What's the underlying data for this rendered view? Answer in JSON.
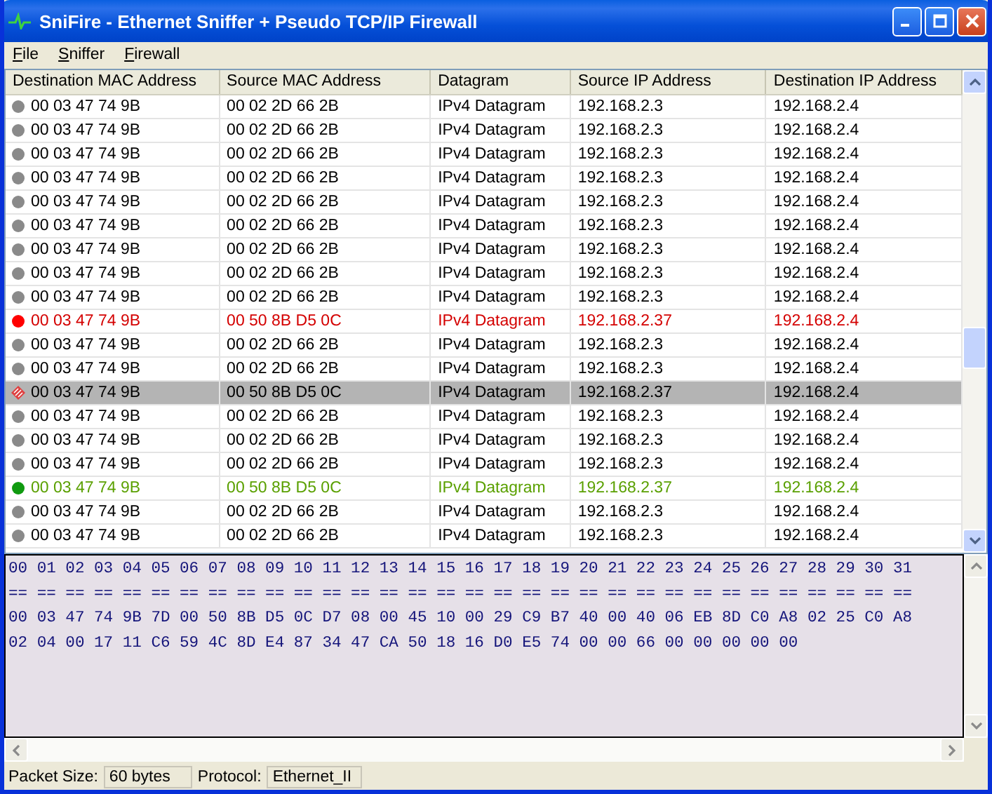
{
  "window": {
    "title": "SniFire - Ethernet Sniffer + Pseudo TCP/IP Firewall"
  },
  "menu": [
    {
      "label": "File"
    },
    {
      "label": "Sniffer"
    },
    {
      "label": "Firewall"
    }
  ],
  "columns": [
    "Destination MAC Address",
    "Source MAC Address",
    "Datagram",
    "Source IP Address",
    "Destination IP Address"
  ],
  "rows": [
    {
      "kind": "normal",
      "selected": false,
      "cells": [
        "00 03 47 74 9B",
        "00 02 2D 66 2B",
        "IPv4 Datagram",
        "192.168.2.3",
        "192.168.2.4"
      ]
    },
    {
      "kind": "normal",
      "selected": false,
      "cells": [
        "00 03 47 74 9B",
        "00 02 2D 66 2B",
        "IPv4 Datagram",
        "192.168.2.3",
        "192.168.2.4"
      ]
    },
    {
      "kind": "normal",
      "selected": false,
      "cells": [
        "00 03 47 74 9B",
        "00 02 2D 66 2B",
        "IPv4 Datagram",
        "192.168.2.3",
        "192.168.2.4"
      ]
    },
    {
      "kind": "normal",
      "selected": false,
      "cells": [
        "00 03 47 74 9B",
        "00 02 2D 66 2B",
        "IPv4 Datagram",
        "192.168.2.3",
        "192.168.2.4"
      ]
    },
    {
      "kind": "normal",
      "selected": false,
      "cells": [
        "00 03 47 74 9B",
        "00 02 2D 66 2B",
        "IPv4 Datagram",
        "192.168.2.3",
        "192.168.2.4"
      ]
    },
    {
      "kind": "normal",
      "selected": false,
      "cells": [
        "00 03 47 74 9B",
        "00 02 2D 66 2B",
        "IPv4 Datagram",
        "192.168.2.3",
        "192.168.2.4"
      ]
    },
    {
      "kind": "normal",
      "selected": false,
      "cells": [
        "00 03 47 74 9B",
        "00 02 2D 66 2B",
        "IPv4 Datagram",
        "192.168.2.3",
        "192.168.2.4"
      ]
    },
    {
      "kind": "normal",
      "selected": false,
      "cells": [
        "00 03 47 74 9B",
        "00 02 2D 66 2B",
        "IPv4 Datagram",
        "192.168.2.3",
        "192.168.2.4"
      ]
    },
    {
      "kind": "normal",
      "selected": false,
      "cells": [
        "00 03 47 74 9B",
        "00 02 2D 66 2B",
        "IPv4 Datagram",
        "192.168.2.3",
        "192.168.2.4"
      ]
    },
    {
      "kind": "blocked",
      "selected": false,
      "cells": [
        "00 03 47 74 9B",
        "00 50 8B D5 0C",
        "IPv4 Datagram",
        "192.168.2.37",
        "192.168.2.4"
      ]
    },
    {
      "kind": "normal",
      "selected": false,
      "cells": [
        "00 03 47 74 9B",
        "00 02 2D 66 2B",
        "IPv4 Datagram",
        "192.168.2.3",
        "192.168.2.4"
      ]
    },
    {
      "kind": "normal",
      "selected": false,
      "cells": [
        "00 03 47 74 9B",
        "00 02 2D 66 2B",
        "IPv4 Datagram",
        "192.168.2.3",
        "192.168.2.4"
      ]
    },
    {
      "kind": "blocked",
      "selected": true,
      "cells": [
        "00 03 47 74 9B",
        "00 50 8B D5 0C",
        "IPv4 Datagram",
        "192.168.2.37",
        "192.168.2.4"
      ]
    },
    {
      "kind": "normal",
      "selected": false,
      "cells": [
        "00 03 47 74 9B",
        "00 02 2D 66 2B",
        "IPv4 Datagram",
        "192.168.2.3",
        "192.168.2.4"
      ]
    },
    {
      "kind": "normal",
      "selected": false,
      "cells": [
        "00 03 47 74 9B",
        "00 02 2D 66 2B",
        "IPv4 Datagram",
        "192.168.2.3",
        "192.168.2.4"
      ]
    },
    {
      "kind": "normal",
      "selected": false,
      "cells": [
        "00 03 47 74 9B",
        "00 02 2D 66 2B",
        "IPv4 Datagram",
        "192.168.2.3",
        "192.168.2.4"
      ]
    },
    {
      "kind": "allowed",
      "selected": false,
      "cells": [
        "00 03 47 74 9B",
        "00 50 8B D5 0C",
        "IPv4 Datagram",
        "192.168.2.37",
        "192.168.2.4"
      ]
    },
    {
      "kind": "normal",
      "selected": false,
      "cells": [
        "00 03 47 74 9B",
        "00 02 2D 66 2B",
        "IPv4 Datagram",
        "192.168.2.3",
        "192.168.2.4"
      ]
    },
    {
      "kind": "normal",
      "selected": false,
      "cells": [
        "00 03 47 74 9B",
        "00 02 2D 66 2B",
        "IPv4 Datagram",
        "192.168.2.3",
        "192.168.2.4"
      ]
    }
  ],
  "hex_dump": [
    "00 01 02 03 04 05 06 07 08 09 10 11 12 13 14 15 16 17 18 19 20 21 22 23 24 25 26 27 28 29 30 31",
    "== == == == == == == == == == == == == == == == == == == == == == == == == == == == == == == ==",
    "00 03 47 74 9B 7D 00 50 8B D5 0C D7 08 00 45 10 00 29 C9 B7 40 00 40 06 EB 8D C0 A8 02 25 C0 A8",
    "02 04 00 17 11 C6 59 4C 8D E4 87 34 47 CA 50 18 16 D0 E5 74 00 00 66 00 00 00 00 00"
  ],
  "status_bar": {
    "packet_size_label": "Packet Size:",
    "packet_size": "60 bytes",
    "protocol_label": "Protocol:",
    "protocol": "Ethernet_II"
  }
}
